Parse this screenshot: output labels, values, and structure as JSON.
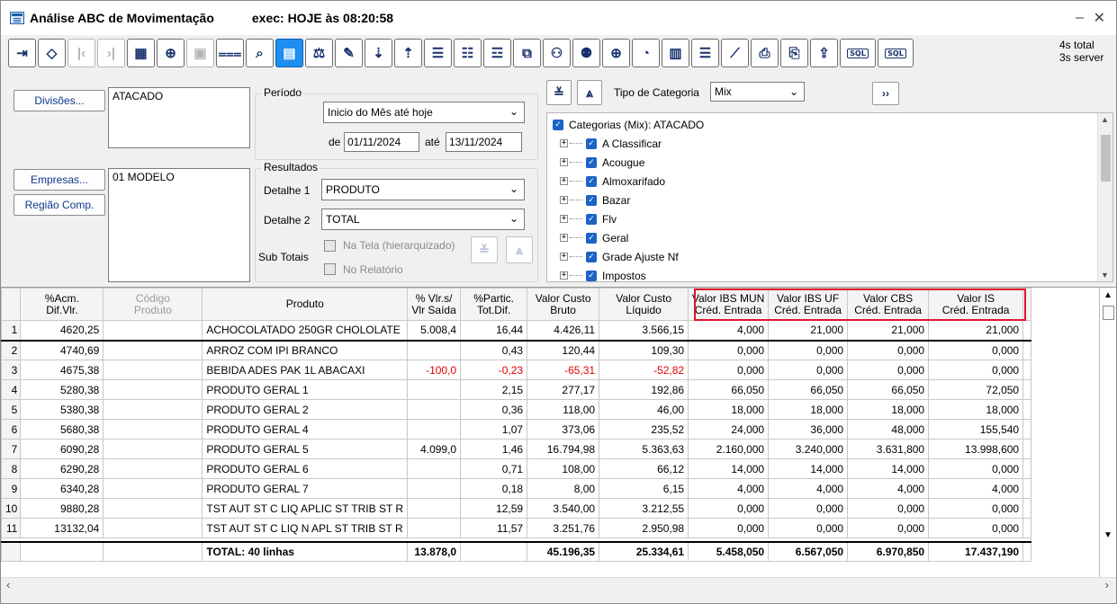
{
  "window": {
    "title": "Análise ABC de Movimentação",
    "exec": "exec: HOJE às 08:20:58",
    "minimize": "–",
    "close": "✕"
  },
  "toolbar": {
    "buttons": [
      {
        "name": "exit",
        "glyph": "⇥"
      },
      {
        "name": "eraser",
        "glyph": "◇"
      },
      {
        "name": "first",
        "glyph": "|‹",
        "disabled": true
      },
      {
        "name": "last",
        "glyph": "›|",
        "disabled": true
      },
      {
        "name": "grid",
        "glyph": "▦"
      },
      {
        "name": "add",
        "glyph": "⊕"
      },
      {
        "name": "save",
        "glyph": "▣",
        "disabled": true
      },
      {
        "name": "filter",
        "glyph": "⩶"
      },
      {
        "name": "search",
        "glyph": "⌕"
      },
      {
        "name": "calculator",
        "glyph": "▤",
        "active": true
      },
      {
        "name": "balance",
        "glyph": "⚖"
      },
      {
        "name": "edit",
        "glyph": "✎"
      },
      {
        "name": "sort-desc",
        "glyph": "⇣"
      },
      {
        "name": "sort-asc",
        "glyph": "⇡"
      },
      {
        "name": "list-1",
        "glyph": "☰"
      },
      {
        "name": "list-2",
        "glyph": "☷"
      },
      {
        "name": "list-3",
        "glyph": "☲"
      },
      {
        "name": "external",
        "glyph": "⧉"
      },
      {
        "name": "person-1",
        "glyph": "⚇"
      },
      {
        "name": "person-2",
        "glyph": "⚉"
      },
      {
        "name": "zoom",
        "glyph": "⊕"
      },
      {
        "name": "pie",
        "glyph": "◔"
      },
      {
        "name": "bar-chart",
        "glyph": "▥"
      },
      {
        "name": "hbar-chart",
        "glyph": "☰"
      },
      {
        "name": "line-chart",
        "glyph": "⟋"
      },
      {
        "name": "print",
        "glyph": "⎙"
      },
      {
        "name": "print-stack",
        "glyph": "⎘"
      },
      {
        "name": "file-export",
        "glyph": "⇪"
      },
      {
        "name": "sql-1",
        "glyph": "SQL",
        "wide": true
      },
      {
        "name": "sql-2",
        "glyph": "SQL",
        "wide": true
      }
    ],
    "timing_total": "4s total",
    "timing_server": "3s server"
  },
  "filters": {
    "divisoes_label": "Divisões...",
    "divisoes_value": "ATACADO",
    "empresas_label": "Empresas...",
    "empresas_value": "01 MODELO",
    "regiao_label": "Região Comp.",
    "periodo_label": "Período",
    "periodo_value": "Inicio do Mês até hoje",
    "de_label": "de",
    "date_from": "01/11/2024",
    "ate_label": "até",
    "date_to": "13/11/2024",
    "resultados_label": "Resultados",
    "detalhe1_label": "Detalhe 1",
    "detalhe1_value": "PRODUTO",
    "detalhe2_label": "Detalhe 2",
    "detalhe2_value": "TOTAL",
    "subtotais_label": "Sub Totais",
    "na_tela_label": "Na Tela (hierarquizado)",
    "no_relatorio_label": "No Relatório",
    "tipo_categoria_label": "Tipo de Categoria",
    "tipo_categoria_value": "Mix"
  },
  "tree": {
    "root": "Categorias (Mix): ATACADO",
    "items": [
      "A Classificar",
      "Acougue",
      "Almoxarifado",
      "Bazar",
      "Flv",
      "Geral",
      "Grade Ajuste Nf",
      "Impostos"
    ]
  },
  "grid": {
    "headers": [
      {
        "l1": "%Acm.",
        "l2": "Dif.Vlr."
      },
      {
        "l1": "Código",
        "l2": "Produto",
        "gray": true
      },
      {
        "l1": "Produto",
        "l2": ""
      },
      {
        "l1": "% Vlr.s/",
        "l2": "Vlr Saída"
      },
      {
        "l1": "%Partic.",
        "l2": "Tot.Dif."
      },
      {
        "l1": "Valor Custo",
        "l2": "Bruto"
      },
      {
        "l1": "Valor Custo",
        "l2": "Líquido"
      },
      {
        "l1": "Valor IBS MUN",
        "l2": "Créd. Entrada"
      },
      {
        "l1": "Valor IBS UF",
        "l2": "Créd. Entrada"
      },
      {
        "l1": "Valor CBS",
        "l2": "Créd. Entrada"
      },
      {
        "l1": "Valor IS",
        "l2": "Créd. Entrada"
      }
    ],
    "rows": [
      {
        "n": "1",
        "acm": "4620,25",
        "cod": "",
        "prod": "ACHOCOLATADO 250GR CHOLOLATE",
        "pvs": "5.008,4",
        "part": "16,44",
        "bruto": "4.426,11",
        "liq": "3.566,15",
        "mun": "4,000",
        "uf": "21,000",
        "cbs": "21,000",
        "is": "21,000"
      },
      {
        "n": "2",
        "acm": "4740,69",
        "cod": "",
        "prod": "ARROZ COM IPI BRANCO",
        "pvs": "",
        "part": "0,43",
        "bruto": "120,44",
        "liq": "109,30",
        "mun": "0,000",
        "uf": "0,000",
        "cbs": "0,000",
        "is": "0,000"
      },
      {
        "n": "3",
        "acm": "4675,38",
        "cod": "",
        "prod": "BEBIDA ADES PAK 1L ABACAXI",
        "pvs": "-100,0",
        "part": "-0,23",
        "bruto": "-65,31",
        "liq": "-52,82",
        "mun": "0,000",
        "uf": "0,000",
        "cbs": "0,000",
        "is": "0,000",
        "red": true
      },
      {
        "n": "4",
        "acm": "5280,38",
        "cod": "",
        "prod": "PRODUTO GERAL 1",
        "pvs": "",
        "part": "2,15",
        "bruto": "277,17",
        "liq": "192,86",
        "mun": "66,050",
        "uf": "66,050",
        "cbs": "66,050",
        "is": "72,050"
      },
      {
        "n": "5",
        "acm": "5380,38",
        "cod": "",
        "prod": "PRODUTO GERAL 2",
        "pvs": "",
        "part": "0,36",
        "bruto": "118,00",
        "liq": "46,00",
        "mun": "18,000",
        "uf": "18,000",
        "cbs": "18,000",
        "is": "18,000"
      },
      {
        "n": "6",
        "acm": "5680,38",
        "cod": "",
        "prod": "PRODUTO GERAL 4",
        "pvs": "",
        "part": "1,07",
        "bruto": "373,06",
        "liq": "235,52",
        "mun": "24,000",
        "uf": "36,000",
        "cbs": "48,000",
        "is": "155,540"
      },
      {
        "n": "7",
        "acm": "6090,28",
        "cod": "",
        "prod": "PRODUTO GERAL 5",
        "pvs": "4.099,0",
        "part": "1,46",
        "bruto": "16.794,98",
        "liq": "5.363,63",
        "mun": "2.160,000",
        "uf": "3.240,000",
        "cbs": "3.631,800",
        "is": "13.998,600"
      },
      {
        "n": "8",
        "acm": "6290,28",
        "cod": "",
        "prod": "PRODUTO GERAL 6",
        "pvs": "",
        "part": "0,71",
        "bruto": "108,00",
        "liq": "66,12",
        "mun": "14,000",
        "uf": "14,000",
        "cbs": "14,000",
        "is": "0,000"
      },
      {
        "n": "9",
        "acm": "6340,28",
        "cod": "",
        "prod": "PRODUTO GERAL 7",
        "pvs": "",
        "part": "0,18",
        "bruto": "8,00",
        "liq": "6,15",
        "mun": "4,000",
        "uf": "4,000",
        "cbs": "4,000",
        "is": "4,000"
      },
      {
        "n": "10",
        "acm": "9880,28",
        "cod": "",
        "prod": "TST AUT ST C LIQ APLIC ST TRIB ST R",
        "pvs": "",
        "part": "12,59",
        "bruto": "3.540,00",
        "liq": "3.212,55",
        "mun": "0,000",
        "uf": "0,000",
        "cbs": "0,000",
        "is": "0,000"
      },
      {
        "n": "11",
        "acm": "13132,04",
        "cod": "",
        "prod": "TST AUT ST C LIQ N APL ST TRIB ST R",
        "pvs": "",
        "part": "11,57",
        "bruto": "3.251,76",
        "liq": "2.950,98",
        "mun": "0,000",
        "uf": "0,000",
        "cbs": "0,000",
        "is": "0,000"
      }
    ],
    "total": {
      "label": "TOTAL: 40 linhas",
      "pvs": "13.878,0",
      "bruto": "45.196,35",
      "liq": "25.334,61",
      "mun": "5.458,050",
      "uf": "6.567,050",
      "cbs": "6.970,850",
      "is": "17.437,190"
    }
  },
  "colors": {
    "highlight_border": "#e0152b",
    "negative_text": "#e00000",
    "active_button": "#1f8ef1",
    "checkbox": "#1b63c7"
  }
}
